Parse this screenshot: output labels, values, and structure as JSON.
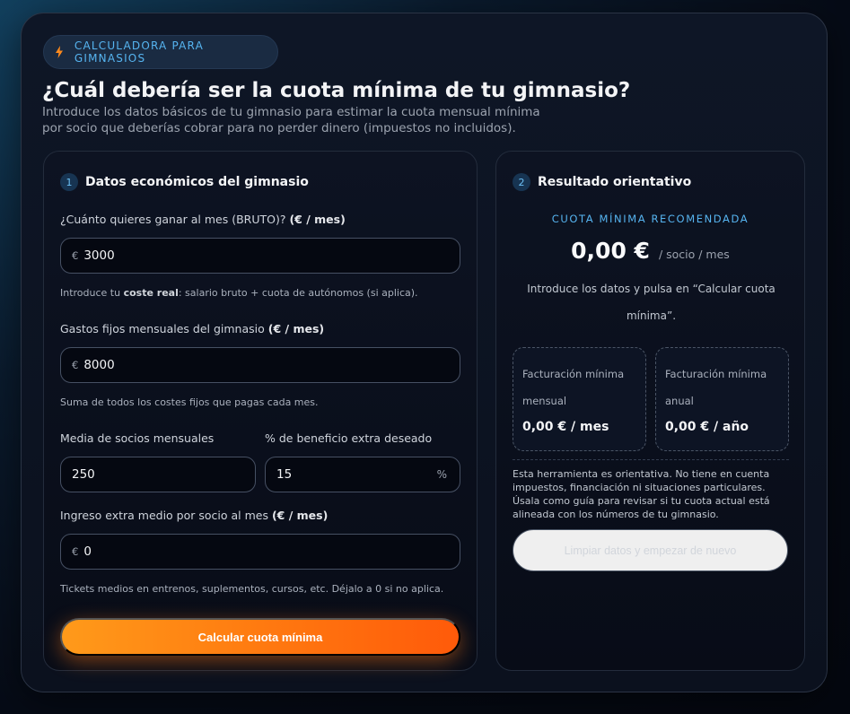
{
  "header": {
    "badge": "CALCULADORA PARA GIMNASIOS",
    "title": "¿Cuál debería ser la cuota mínima de tu gimnasio?",
    "subtitle": "Introduce los datos básicos de tu gimnasio para estimar la cuota mensual mínima por socio que deberías cobrar para no perder dinero (impuestos no incluidos)."
  },
  "form": {
    "step_number": "1",
    "step_title": "Datos económicos del gimnasio",
    "salary": {
      "label": "¿Cuánto quieres ganar al mes (BRUTO)?",
      "label_unit": "(€ / mes)",
      "prefix": "€",
      "value": "3000",
      "help_pre": "Introduce tu",
      "help_bold": "coste real",
      "help_post": ": salario bruto + cuota de autónomos (si aplica)."
    },
    "fixed_costs": {
      "label": "Gastos fijos mensuales del gimnasio",
      "label_unit": "(€ / mes)",
      "prefix": "€",
      "value": "8000",
      "help": "Suma de todos los costes fijos que pagas cada mes."
    },
    "members": {
      "label": "Media de socios mensuales",
      "value": "250"
    },
    "profit": {
      "label": "% de beneficio extra deseado",
      "value": "15",
      "suffix": "%"
    },
    "extra_income": {
      "label": "Ingreso extra medio por socio al mes",
      "label_unit": "(€ / mes)",
      "prefix": "€",
      "value": "0",
      "help": "Tickets medios en entrenos, suplementos, cursos, etc. Déjalo a 0 si no aplica."
    },
    "submit_label": "Calcular cuota mínima"
  },
  "result": {
    "step_number": "2",
    "step_title": "Resultado orientativo",
    "kicker": "CUOTA MÍNIMA RECOMENDADA",
    "amount": "0,00 €",
    "unit": "/ socio / mes",
    "note": "Introduce los datos y pulsa en “Calcular cuota mínima”.",
    "monthly": {
      "label": "Facturación mínima mensual",
      "value": "0,00 € / mes"
    },
    "annual": {
      "label": "Facturación mínima anual",
      "value": "0,00 € / año"
    },
    "disclaimer": "Esta herramienta es orientativa. No tiene en cuenta impuestos, financiación ni situaciones particulares. Úsala como guía para revisar si tu cuota actual está alineada con los números de tu gimnasio.",
    "reset_label": "Limpiar datos y empezar de nuevo"
  },
  "colors": {
    "accent_blue": "#56b4f0",
    "cta_orange": "#ff7a10"
  },
  "icons": {
    "badge_icon": "lightning-bolt-icon"
  }
}
